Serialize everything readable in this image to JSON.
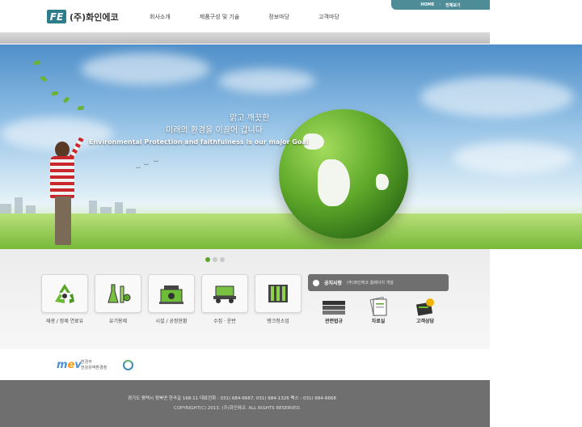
{
  "header": {
    "logo_mark": "FE",
    "logo_text": "(주)화인에코",
    "util": {
      "home": "HOME",
      "sitemap": "전체보기"
    },
    "nav": [
      "회사소개",
      "제품구성 및 기술",
      "정보마당",
      "고객마당"
    ]
  },
  "hero": {
    "line1": "맑고 깨끗한",
    "line2": "미래의 환경을 이끌어 갑니다",
    "line3": "Environmental Protection and faithfulness is our major Goal"
  },
  "services": [
    {
      "label": "재생 / 정제 연료유",
      "icon": "recycle-icon"
    },
    {
      "label": "유기용제",
      "icon": "flask-icon"
    },
    {
      "label": "시설 / 공정현황",
      "icon": "facility-icon"
    },
    {
      "label": "수집 · 운반",
      "icon": "truck-icon"
    },
    {
      "label": "탱크청소업",
      "icon": "tank-icon"
    }
  ],
  "notice": {
    "title": "공지사항",
    "text": "(주)화인에코 홈페이지 개설"
  },
  "quick_links": [
    {
      "label": "관련법규",
      "icon": "books-icon"
    },
    {
      "label": "자료실",
      "icon": "documents-icon"
    },
    {
      "label": "고객상담",
      "icon": "consult-icon"
    }
  ],
  "partner": {
    "mev_ministry": "환경부",
    "mev_sub": "한강유역환경청"
  },
  "footer": {
    "line1": "경기도 평택시 청북면 현곡길 168-11   대표전화 : 031) 684-6667, 031) 684-1326   팩스 : 031) 684-6668",
    "line2": "COPYRIGHT(C) 2013. (주)화인에코. ALL RIGHTS RESERVED."
  },
  "colors": {
    "brand": "#2f7d8c",
    "accent_green": "#5aa62b",
    "footer_bg": "#6f6f6f"
  }
}
